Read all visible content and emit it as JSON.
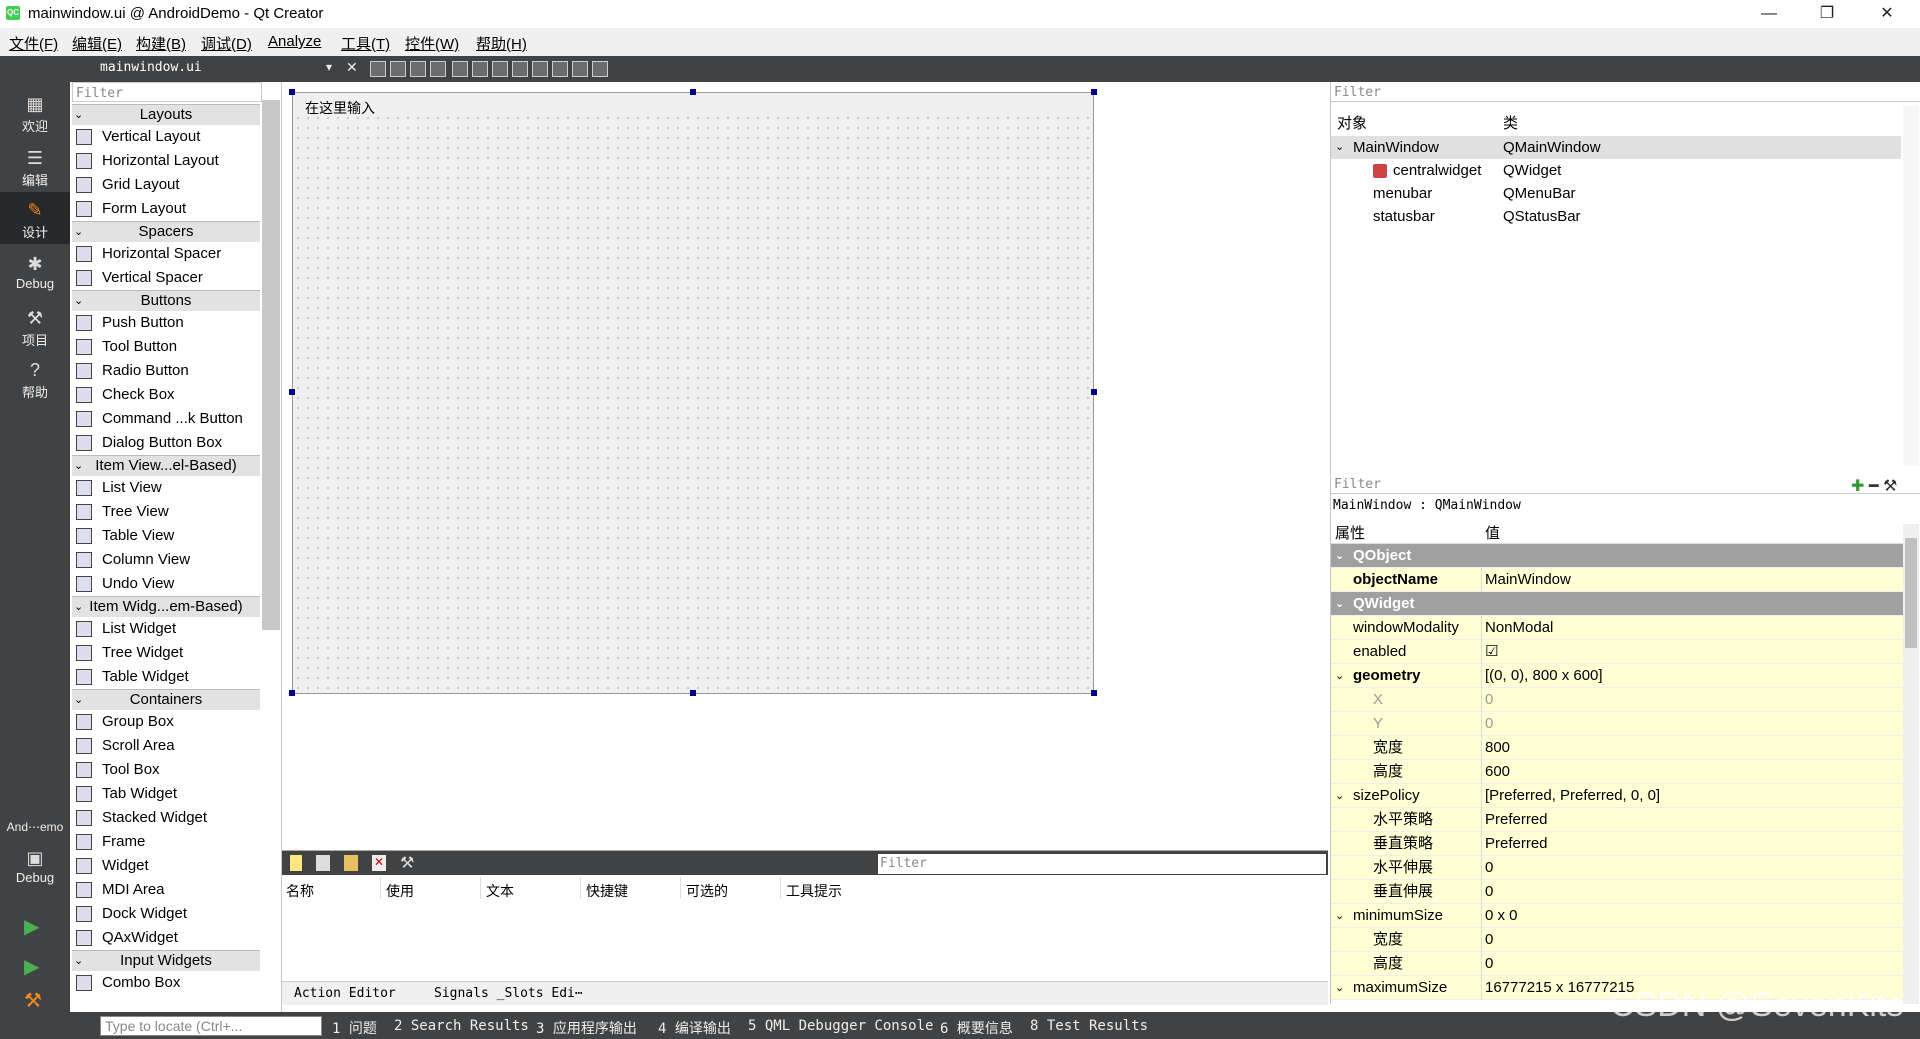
{
  "window": {
    "title": "mainwindow.ui @ AndroidDemo - Qt Creator",
    "logo": "QC",
    "minimize": "—",
    "restore": "❐",
    "close": "✕"
  },
  "menubar": [
    "文件(F)",
    "编辑(E)",
    "构建(B)",
    "调试(D)",
    "Analyze",
    "工具(T)",
    "控件(W)",
    "帮助(H)"
  ],
  "modes": {
    "items": [
      {
        "label": "欢迎",
        "icon": "grid-icon"
      },
      {
        "label": "编辑",
        "icon": "edit-icon"
      },
      {
        "label": "设计",
        "icon": "pencil-icon"
      },
      {
        "label": "Debug",
        "icon": "bug-icon"
      },
      {
        "label": "项目",
        "icon": "wrench-icon"
      },
      {
        "label": "帮助",
        "icon": "help-icon"
      }
    ],
    "kit_label": "And⋯emo",
    "kit_mode": "Debug"
  },
  "toolbar": {
    "document": "mainwindow.ui",
    "close": "✕"
  },
  "widgetbox": {
    "filter": "Filter",
    "categories": [
      {
        "name": "Layouts",
        "items": [
          "Vertical Layout",
          "Horizontal Layout",
          "Grid Layout",
          "Form Layout"
        ]
      },
      {
        "name": "Spacers",
        "items": [
          "Horizontal Spacer",
          "Vertical Spacer"
        ]
      },
      {
        "name": "Buttons",
        "items": [
          "Push Button",
          "Tool Button",
          "Radio Button",
          "Check Box",
          "Command ...k Button",
          "Dialog Button Box"
        ]
      },
      {
        "name": "Item View...el-Based)",
        "items": [
          "List View",
          "Tree View",
          "Table View",
          "Column View",
          "Undo View"
        ]
      },
      {
        "name": "Item Widg...em-Based)",
        "items": [
          "List Widget",
          "Tree Widget",
          "Table Widget"
        ]
      },
      {
        "name": "Containers",
        "items": [
          "Group Box",
          "Scroll Area",
          "Tool Box",
          "Tab Widget",
          "Stacked Widget",
          "Frame",
          "Widget",
          "MDI Area",
          "Dock Widget",
          "QAxWidget"
        ]
      },
      {
        "name": "Input Widgets",
        "items": [
          "Combo Box"
        ]
      }
    ]
  },
  "form": {
    "menu_placeholder": "在这里输入"
  },
  "action_editor": {
    "filter": "Filter",
    "columns": [
      "名称",
      "使用",
      "文本",
      "快捷键",
      "可选的",
      "工具提示"
    ],
    "tabs": [
      "Action Editor",
      "Signals _Slots Edi⋯"
    ]
  },
  "object_inspector": {
    "filter": "Filter",
    "headers": [
      "对象",
      "类"
    ],
    "rows": [
      {
        "object": "MainWindow",
        "class": "QMainWindow"
      },
      {
        "object": "centralwidget",
        "class": "QWidget"
      },
      {
        "object": "menubar",
        "class": "QMenuBar"
      },
      {
        "object": "statusbar",
        "class": "QStatusBar"
      }
    ]
  },
  "property_editor": {
    "filter": "Filter",
    "class_line": "MainWindow : QMainWindow",
    "headers": [
      "属性",
      "值"
    ],
    "rows": [
      {
        "name": "QObject",
        "value": "",
        "type": "group"
      },
      {
        "name": "objectName",
        "value": "MainWindow",
        "type": "bold"
      },
      {
        "name": "QWidget",
        "value": "",
        "type": "group"
      },
      {
        "name": "windowModality",
        "value": "NonModal",
        "type": "normal"
      },
      {
        "name": "enabled",
        "value": "☑",
        "type": "normal"
      },
      {
        "name": "geometry",
        "value": "[(0, 0), 800 x 600]",
        "type": "boldexp"
      },
      {
        "name": "X",
        "value": "0",
        "type": "subdim"
      },
      {
        "name": "Y",
        "value": "0",
        "type": "subdim"
      },
      {
        "name": "宽度",
        "value": "800",
        "type": "sub"
      },
      {
        "name": "高度",
        "value": "600",
        "type": "sub"
      },
      {
        "name": "sizePolicy",
        "value": "[Preferred, Preferred, 0, 0]",
        "type": "exp"
      },
      {
        "name": "水平策略",
        "value": "Preferred",
        "type": "sub"
      },
      {
        "name": "垂直策略",
        "value": "Preferred",
        "type": "sub"
      },
      {
        "name": "水平伸展",
        "value": "0",
        "type": "sub"
      },
      {
        "name": "垂直伸展",
        "value": "0",
        "type": "sub"
      },
      {
        "name": "minimumSize",
        "value": "0 x 0",
        "type": "exp"
      },
      {
        "name": "宽度",
        "value": "0",
        "type": "sub"
      },
      {
        "name": "高度",
        "value": "0",
        "type": "sub"
      },
      {
        "name": "maximumSize",
        "value": "16777215 x 16777215",
        "type": "exp"
      }
    ]
  },
  "statusbar": {
    "locate_placeholder": "Type to locate (Ctrl+...",
    "panes": [
      "1 问题",
      "2 Search Results",
      "3 应用程序输出",
      "4 编译输出",
      "5 QML Debugger Console",
      "6 概要信息",
      "8 Test Results"
    ]
  },
  "watermark": "CSDN @SevenKits"
}
